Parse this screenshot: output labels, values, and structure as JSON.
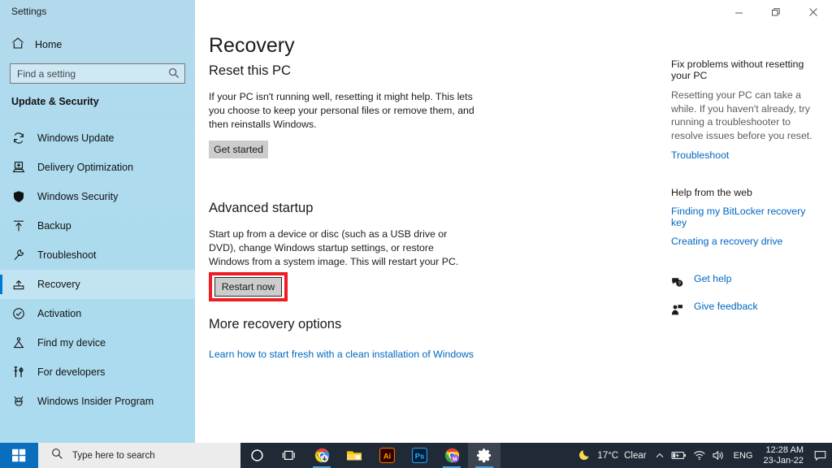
{
  "window": {
    "app_title": "Settings",
    "controls": {
      "minimize": "Minimize",
      "restore": "Restore",
      "close": "Close"
    }
  },
  "sidebar": {
    "home_label": "Home",
    "search_placeholder": "Find a setting",
    "search_value": "",
    "group_title": "Update & Security",
    "items": [
      {
        "label": "Windows Update",
        "icon": "sync-icon",
        "selected": false
      },
      {
        "label": "Delivery Optimization",
        "icon": "delivery-icon",
        "selected": false
      },
      {
        "label": "Windows Security",
        "icon": "shield-icon",
        "selected": false
      },
      {
        "label": "Backup",
        "icon": "upload-arrow-icon",
        "selected": false
      },
      {
        "label": "Troubleshoot",
        "icon": "wrench-icon",
        "selected": false
      },
      {
        "label": "Recovery",
        "icon": "recovery-icon",
        "selected": true
      },
      {
        "label": "Activation",
        "icon": "check-circle-icon",
        "selected": false
      },
      {
        "label": "Find my device",
        "icon": "find-device-icon",
        "selected": false
      },
      {
        "label": "For developers",
        "icon": "developer-tools-icon",
        "selected": false
      },
      {
        "label": "Windows Insider Program",
        "icon": "insider-bug-icon",
        "selected": false
      }
    ]
  },
  "main": {
    "page_title": "Recovery",
    "reset": {
      "heading": "Reset this PC",
      "body": "If your PC isn't running well, resetting it might help. This lets you choose to keep your personal files or remove them, and then reinstalls Windows.",
      "button": "Get started"
    },
    "advanced": {
      "heading": "Advanced startup",
      "body": "Start up from a device or disc (such as a USB drive or DVD), change Windows startup settings, or restore Windows from a system image. This will restart your PC.",
      "button": "Restart now",
      "highlight_color": "#ee1d23"
    },
    "more": {
      "heading": "More recovery options",
      "link": "Learn how to start fresh with a clean installation of Windows"
    }
  },
  "rail": {
    "fix_heading": "Fix problems without resetting your PC",
    "fix_body": "Resetting your PC can take a while. If you haven't already, try running a troubleshooter to resolve issues before you reset.",
    "fix_link": "Troubleshoot",
    "web_heading": "Help from the web",
    "web_links": [
      "Finding my BitLocker recovery key",
      "Creating a recovery drive"
    ],
    "actions": [
      {
        "label": "Get help",
        "icon": "help-bubble-icon"
      },
      {
        "label": "Give feedback",
        "icon": "feedback-person-icon"
      }
    ],
    "link_color": "#0067c0"
  },
  "taskbar": {
    "start_label": "Start",
    "search_placeholder": "Type here to search",
    "apps": [
      {
        "name": "cortana-icon",
        "label": "Cortana",
        "state": "idle"
      },
      {
        "name": "task-view-icon",
        "label": "Task View",
        "state": "idle"
      },
      {
        "name": "chrome-icon",
        "label": "Google Chrome",
        "state": "open"
      },
      {
        "name": "file-explorer-icon",
        "label": "File Explorer",
        "state": "idle"
      },
      {
        "name": "illustrator-icon",
        "label": "Ai",
        "state": "idle"
      },
      {
        "name": "photoshop-icon",
        "label": "Ps",
        "state": "idle"
      },
      {
        "name": "chrome-profile-icon",
        "label": "M",
        "state": "open"
      },
      {
        "name": "settings-gear-icon",
        "label": "Settings",
        "state": "active"
      }
    ],
    "tray": {
      "weather_icon": "moon-icon",
      "temperature": "17°C",
      "condition": "Clear",
      "hidden_icons": "chevron-up-icon",
      "battery": "battery-charging-icon",
      "network": "wifi-icon",
      "volume": "speaker-icon",
      "language": "ENG",
      "time": "12:28 AM",
      "date": "23-Jan-22",
      "notifications": "notification-icon"
    }
  }
}
